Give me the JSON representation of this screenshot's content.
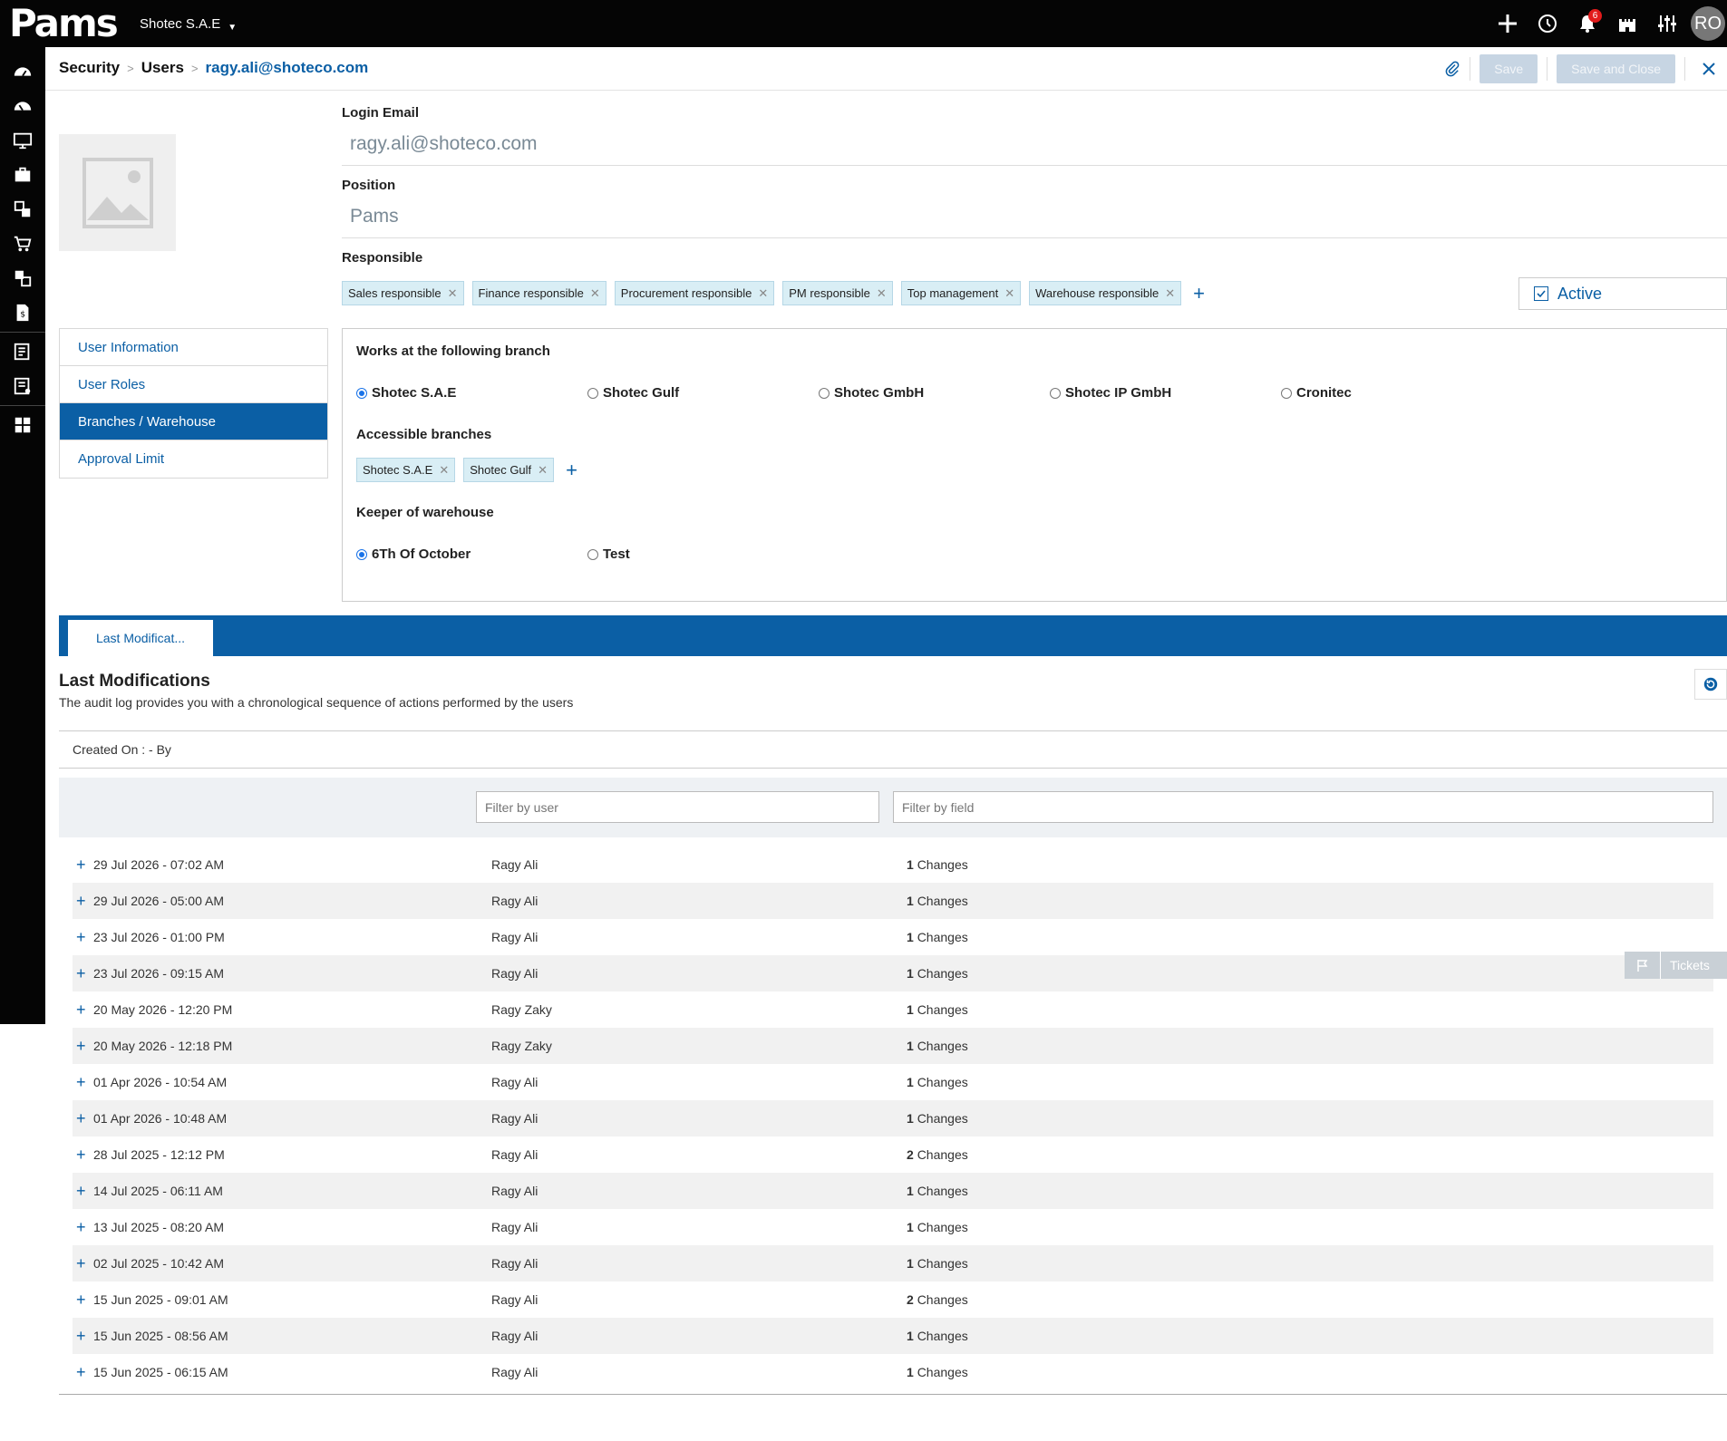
{
  "app": {
    "logo": "Pams",
    "company": "Shotec S.A.E",
    "notifications_count": "6",
    "user_initials": "RO"
  },
  "breadcrumb": {
    "section": "Security",
    "module": "Users",
    "record": "ragy.ali@shoteco.com"
  },
  "actions": {
    "save": "Save",
    "save_close": "Save and Close"
  },
  "form": {
    "login_email_label": "Login Email",
    "login_email_value": "ragy.ali@shoteco.com",
    "position_label": "Position",
    "position_value": "Pams",
    "responsible_label": "Responsible",
    "responsible_tags": [
      "Sales responsible",
      "Finance responsible",
      "Procurement responsible",
      "PM responsible",
      "Top management",
      "Warehouse responsible"
    ],
    "active_label": "Active",
    "active_checked": true
  },
  "sidenav": [
    "User Information",
    "User Roles",
    "Branches / Warehouse",
    "Approval Limit"
  ],
  "branches": {
    "works_title": "Works at the following branch",
    "works_options": [
      "Shotec S.A.E",
      "Shotec Gulf",
      "Shotec GmbH",
      "Shotec IP GmbH",
      "Cronitec"
    ],
    "works_selected": "Shotec S.A.E",
    "accessible_title": "Accessible branches",
    "accessible_tags": [
      "Shotec S.A.E",
      "Shotec Gulf"
    ],
    "keeper_title": "Keeper of warehouse",
    "keeper_options": [
      "6Th Of October",
      "Test"
    ],
    "keeper_selected": "6Th Of October"
  },
  "tab": {
    "label": "Last Modificat..."
  },
  "last_mods": {
    "title": "Last Modifications",
    "description": "The audit log provides you with a chronological sequence of actions performed by the users",
    "created_label": "Created On : - By",
    "filter_user_placeholder": "Filter by user",
    "filter_field_placeholder": "Filter by field",
    "changes_word": "Changes",
    "rows": [
      {
        "date": "29 Jul 2026 - 07:02 AM",
        "user": "Ragy Ali",
        "count": "1"
      },
      {
        "date": "29 Jul 2026 - 05:00 AM",
        "user": "Ragy Ali",
        "count": "1"
      },
      {
        "date": "23 Jul 2026 - 01:00 PM",
        "user": "Ragy Ali",
        "count": "1"
      },
      {
        "date": "23 Jul 2026 - 09:15 AM",
        "user": "Ragy Ali",
        "count": "1"
      },
      {
        "date": "20 May 2026 - 12:20 PM",
        "user": "Ragy Zaky",
        "count": "1"
      },
      {
        "date": "20 May 2026 - 12:18 PM",
        "user": "Ragy Zaky",
        "count": "1"
      },
      {
        "date": "01 Apr 2026 - 10:54 AM",
        "user": "Ragy Ali",
        "count": "1"
      },
      {
        "date": "01 Apr 2026 - 10:48 AM",
        "user": "Ragy Ali",
        "count": "1"
      },
      {
        "date": "28 Jul 2025 - 12:12 PM",
        "user": "Ragy Ali",
        "count": "2"
      },
      {
        "date": "14 Jul 2025 - 06:11 AM",
        "user": "Ragy Ali",
        "count": "1"
      },
      {
        "date": "13 Jul 2025 - 08:20 AM",
        "user": "Ragy Ali",
        "count": "1"
      },
      {
        "date": "02 Jul 2025 - 10:42 AM",
        "user": "Ragy Ali",
        "count": "1"
      },
      {
        "date": "15 Jun 2025 - 09:01 AM",
        "user": "Ragy Ali",
        "count": "2"
      },
      {
        "date": "15 Jun 2025 - 08:56 AM",
        "user": "Ragy Ali",
        "count": "1"
      },
      {
        "date": "15 Jun 2025 - 06:15 AM",
        "user": "Ragy Ali",
        "count": "1"
      }
    ]
  },
  "tickets": {
    "label": "Tickets"
  },
  "icons": {
    "top": [
      "plus-icon",
      "history-icon",
      "bell-icon",
      "castle-icon",
      "sliders-icon"
    ],
    "rail": [
      "dashboard-icon",
      "dashboard-alt-icon",
      "monitor-icon",
      "briefcase-icon",
      "transfer-icon",
      "cart-icon",
      "exchange-icon",
      "invoice-icon",
      "checklist-icon",
      "report-icon",
      "grid-icon"
    ]
  },
  "colors": {
    "primary": "#0b5fa5",
    "topbar": "#050505",
    "badge": "#e21b1b",
    "tag_bg": "#d9eef5"
  }
}
